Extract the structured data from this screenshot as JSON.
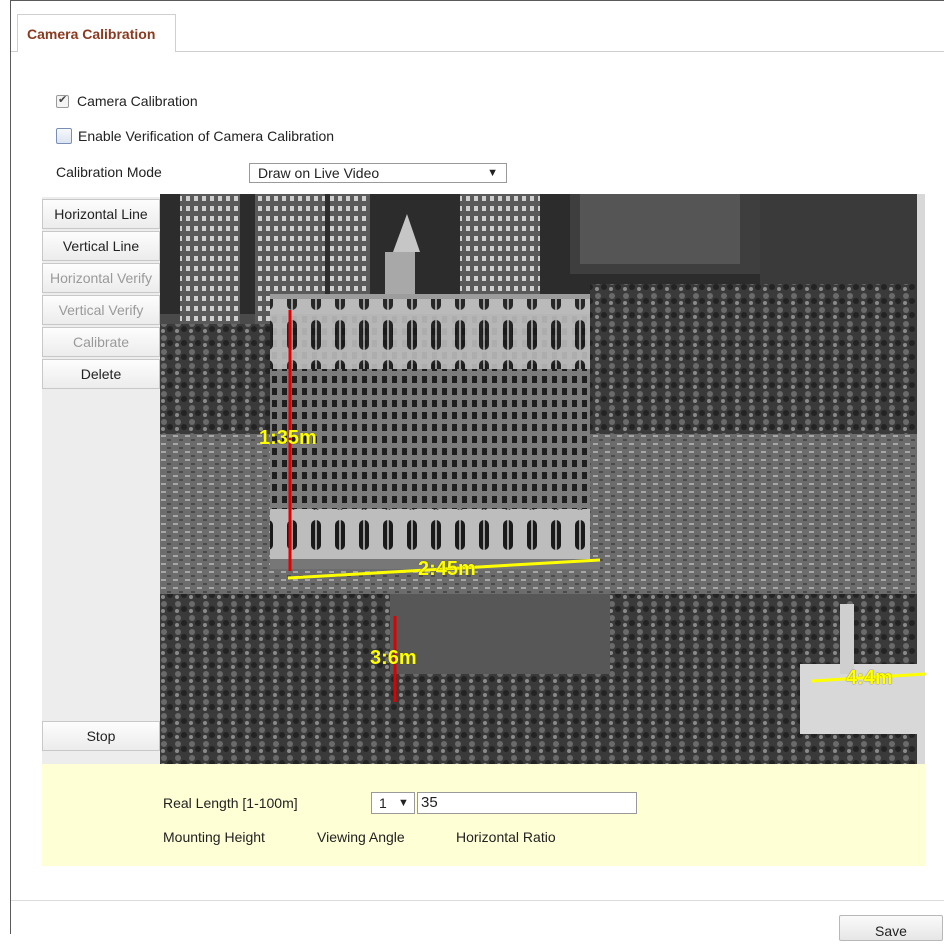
{
  "tab": {
    "label": "Camera Calibration"
  },
  "options": {
    "camera_calibration_label": "Camera Calibration",
    "camera_calibration_checked": true,
    "enable_verification_label": "Enable Verification of Camera Calibration",
    "enable_verification_checked": false
  },
  "calibration_mode": {
    "label": "Calibration Mode",
    "value": "Draw on Live Video"
  },
  "tools": {
    "horizontal_line": "Horizontal Line",
    "vertical_line": "Vertical Line",
    "horizontal_verify": "Horizontal Verify",
    "vertical_verify": "Vertical Verify",
    "calibrate": "Calibrate",
    "delete": "Delete",
    "stop": "Stop"
  },
  "overlays": {
    "building_height": "1:35m",
    "ground_width": "2:45m",
    "small_height": "3:6m",
    "right_width": "4:4m",
    "vertical_color": "#e00000",
    "horizontal_color": "#ffff00"
  },
  "settings": {
    "real_length_label": "Real Length [1-100m]",
    "line_index": "1",
    "real_length_value": "35",
    "mounting_height_label": "Mounting Height",
    "viewing_angle_label": "Viewing Angle",
    "horizontal_ratio_label": "Horizontal Ratio"
  },
  "footer": {
    "save_label": "Save"
  }
}
